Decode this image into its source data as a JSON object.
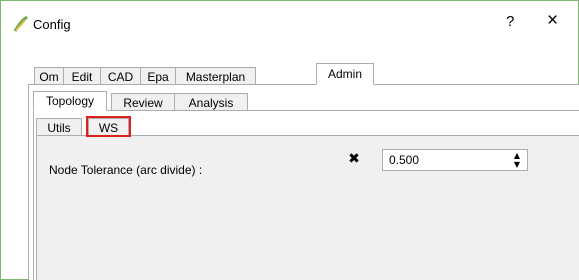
{
  "window": {
    "title": "Config",
    "help_label": "?",
    "close_label": "×"
  },
  "main_tabs": [
    {
      "label": "Om",
      "active": false
    },
    {
      "label": "Edit",
      "active": false
    },
    {
      "label": "CAD",
      "active": false
    },
    {
      "label": "Epa",
      "active": false
    },
    {
      "label": "Masterplan",
      "active": false
    },
    {
      "label": "Admin",
      "active": true
    }
  ],
  "sub_tabs": [
    {
      "label": "Topology",
      "active": true
    },
    {
      "label": "Review",
      "active": false
    },
    {
      "label": "Analysis",
      "active": false
    }
  ],
  "inner_tabs": [
    {
      "label": "Utils",
      "active": false
    },
    {
      "label": "WS",
      "active": true
    }
  ],
  "highlight_color": "#e01e1e",
  "node_tolerance": {
    "label": "Node Tolerance (arc divide) :",
    "checkbox_mark": "✖",
    "value": "0.500",
    "up_arrow": "▲",
    "down_arrow": "▼"
  }
}
